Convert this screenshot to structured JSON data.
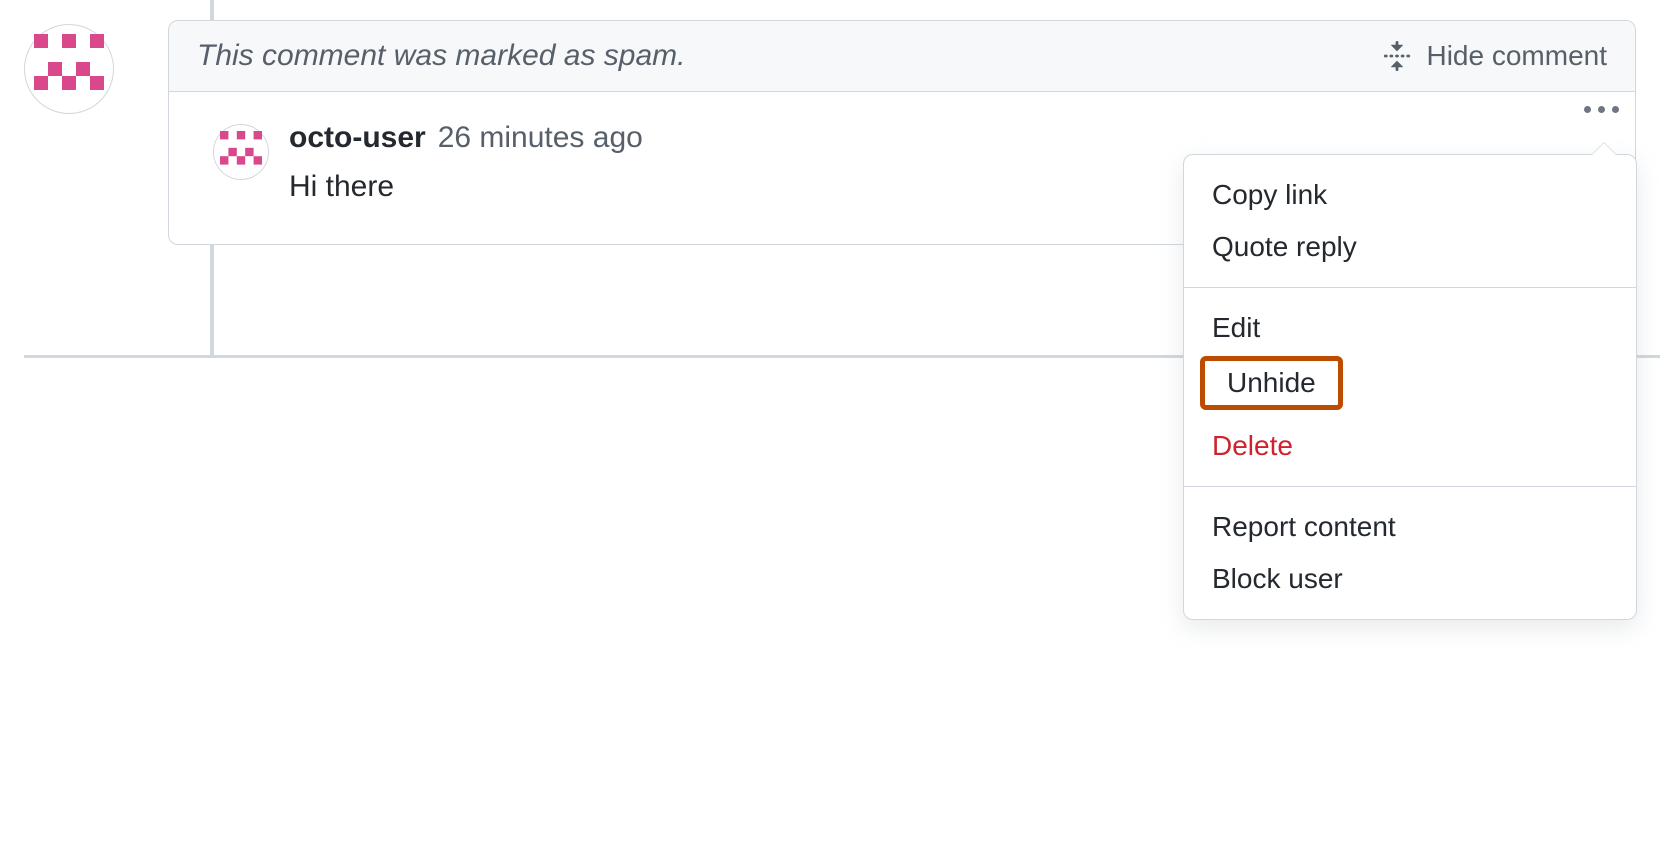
{
  "banner": {
    "spam_notice": "This comment was marked as spam.",
    "hide_label": "Hide comment"
  },
  "comment": {
    "username": "octo-user",
    "timestamp": "26 minutes ago",
    "body": "Hi there"
  },
  "menu": {
    "copy_link": "Copy link",
    "quote_reply": "Quote reply",
    "edit": "Edit",
    "unhide": "Unhide",
    "delete": "Delete",
    "report_content": "Report content",
    "block_user": "Block user"
  },
  "icons": {
    "fold": "fold-icon",
    "kebab": "kebab-icon",
    "identicon": "identicon-avatar"
  },
  "colors": {
    "muted": "#57606a",
    "danger": "#cf222e",
    "highlight_border": "#bc4c00",
    "identicon_pink": "#d9488b",
    "border": "#d0d7de"
  }
}
